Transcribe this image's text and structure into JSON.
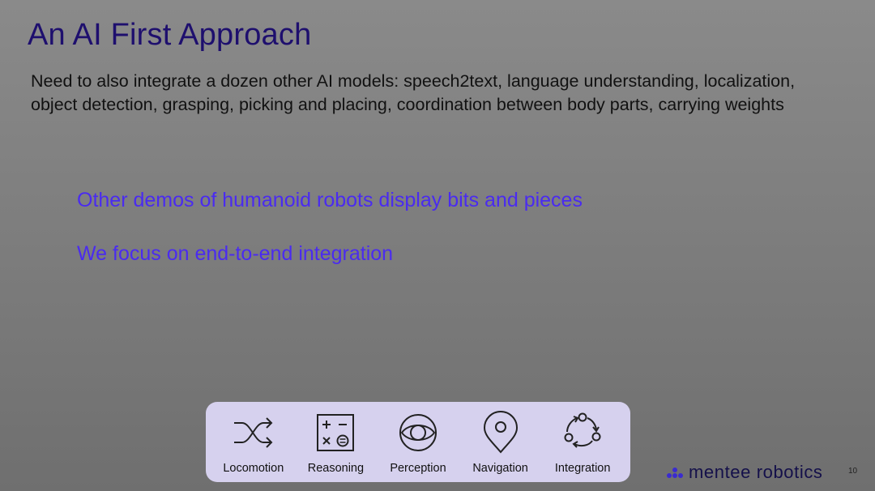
{
  "slide": {
    "title": "An AI First Approach",
    "body": "Need to also integrate a dozen other AI models: speech2text, language understanding, localization, object detection, grasping, picking and placing, coordination between body parts, carrying weights",
    "highlights": [
      "Other demos of humanoid robots display bits and pieces",
      "We focus on end-to-end integration"
    ],
    "capabilities": [
      {
        "label": "Locomotion",
        "icon": "shuffle-arrows-icon"
      },
      {
        "label": "Reasoning",
        "icon": "calculator-icon"
      },
      {
        "label": "Perception",
        "icon": "eye-icon"
      },
      {
        "label": "Navigation",
        "icon": "map-pin-icon"
      },
      {
        "label": "Integration",
        "icon": "cycle-icon"
      }
    ],
    "brand": "mentee robotics",
    "page_number": "10"
  },
  "colors": {
    "title": "#1e0f6e",
    "highlight": "#4a2bf0",
    "capsule_bg": "#d6d1ee",
    "brand": "#14104a"
  }
}
